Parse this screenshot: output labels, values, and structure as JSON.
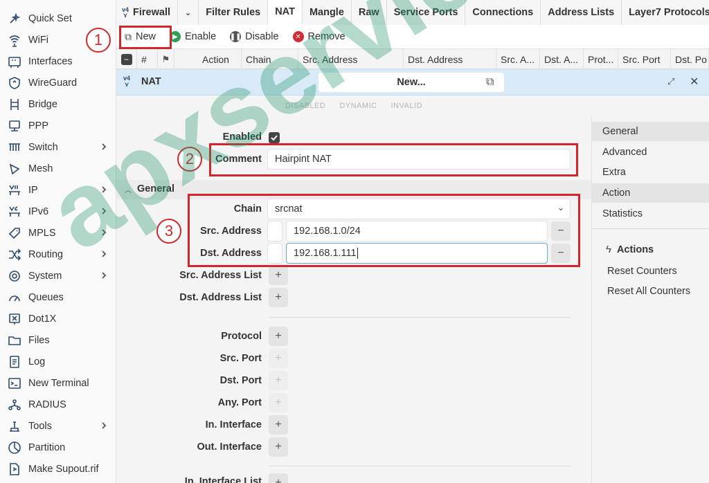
{
  "sidebar": {
    "items": [
      {
        "label": "Quick Set",
        "icon": "quick-set-icon",
        "sub": false
      },
      {
        "label": "WiFi",
        "icon": "wifi-icon",
        "sub": false
      },
      {
        "label": "Interfaces",
        "icon": "interfaces-icon",
        "sub": false
      },
      {
        "label": "WireGuard",
        "icon": "wireguard-icon",
        "sub": false
      },
      {
        "label": "Bridge",
        "icon": "bridge-icon",
        "sub": false
      },
      {
        "label": "PPP",
        "icon": "ppp-icon",
        "sub": false
      },
      {
        "label": "Switch",
        "icon": "switch-icon",
        "sub": true
      },
      {
        "label": "Mesh",
        "icon": "mesh-icon",
        "sub": false
      },
      {
        "label": "IP",
        "icon": "ip-icon",
        "sub": true
      },
      {
        "label": "IPv6",
        "icon": "ipv6-icon",
        "sub": true
      },
      {
        "label": "MPLS",
        "icon": "mpls-icon",
        "sub": true
      },
      {
        "label": "Routing",
        "icon": "routing-icon",
        "sub": true
      },
      {
        "label": "System",
        "icon": "system-gear-icon",
        "sub": true
      },
      {
        "label": "Queues",
        "icon": "queues-icon",
        "sub": false
      },
      {
        "label": "Dot1X",
        "icon": "dot1x-icon",
        "sub": false
      },
      {
        "label": "Files",
        "icon": "folder-icon",
        "sub": false
      },
      {
        "label": "Log",
        "icon": "log-icon",
        "sub": false
      },
      {
        "label": "New Terminal",
        "icon": "terminal-icon",
        "sub": false
      },
      {
        "label": "RADIUS",
        "icon": "radius-icon",
        "sub": false
      },
      {
        "label": "Tools",
        "icon": "tools-icon",
        "sub": true
      },
      {
        "label": "Partition",
        "icon": "partition-icon",
        "sub": false
      },
      {
        "label": "Make Supout.rif",
        "icon": "supout-icon",
        "sub": false
      }
    ]
  },
  "tabs": {
    "firewall": "Firewall",
    "filter_rules": "Filter Rules",
    "nat": "NAT",
    "mangle": "Mangle",
    "raw": "Raw",
    "service_ports": "Service Ports",
    "connections": "Connections",
    "address_lists": "Address Lists",
    "layer7": "Layer7 Protocols"
  },
  "toolbar": {
    "new": "New",
    "enable": "Enable",
    "disable": "Disable",
    "remove": "Remove"
  },
  "table": {
    "headers": [
      "#",
      "Action",
      "Chain",
      "Src. Address",
      "Dst. Address",
      "Src. A...",
      "Dst. A...",
      "Prot...",
      "Src. Port",
      "Dst. Po"
    ]
  },
  "dialog": {
    "title": "NAT",
    "name": "New...",
    "flags": [
      "DISABLED",
      "DYNAMIC",
      "INVALID"
    ],
    "section_general": "General"
  },
  "form": {
    "enabled_label": "Enabled",
    "enabled": true,
    "comment_label": "Comment",
    "comment_value": "Hairpint NAT",
    "chain_label": "Chain",
    "chain_value": "srcnat",
    "src_address_label": "Src. Address",
    "src_address_value": "192.168.1.0/24",
    "dst_address_label": "Dst. Address",
    "dst_address_value": "192.168.1.111",
    "src_address_list_label": "Src. Address List",
    "dst_address_list_label": "Dst. Address List",
    "protocol_label": "Protocol",
    "src_port_label": "Src. Port",
    "dst_port_label": "Dst. Port",
    "any_port_label": "Any. Port",
    "in_interface_label": "In. Interface",
    "out_interface_label": "Out. Interface",
    "in_interface_list_label": "In. Interface List"
  },
  "right_panel": {
    "tabs": [
      "General",
      "Advanced",
      "Extra",
      "Action",
      "Statistics"
    ],
    "selected": [
      "General",
      "Action"
    ],
    "actions_title": "Actions",
    "actions": [
      "Reset Counters",
      "Reset All Counters"
    ]
  },
  "annotations": [
    "1",
    "2",
    "3"
  ],
  "watermark": "apxservices.vn",
  "colors": {
    "accent_red": "#d3262c",
    "dialog_header": "#d8eaf8",
    "watermark_green": "#2a966e"
  }
}
